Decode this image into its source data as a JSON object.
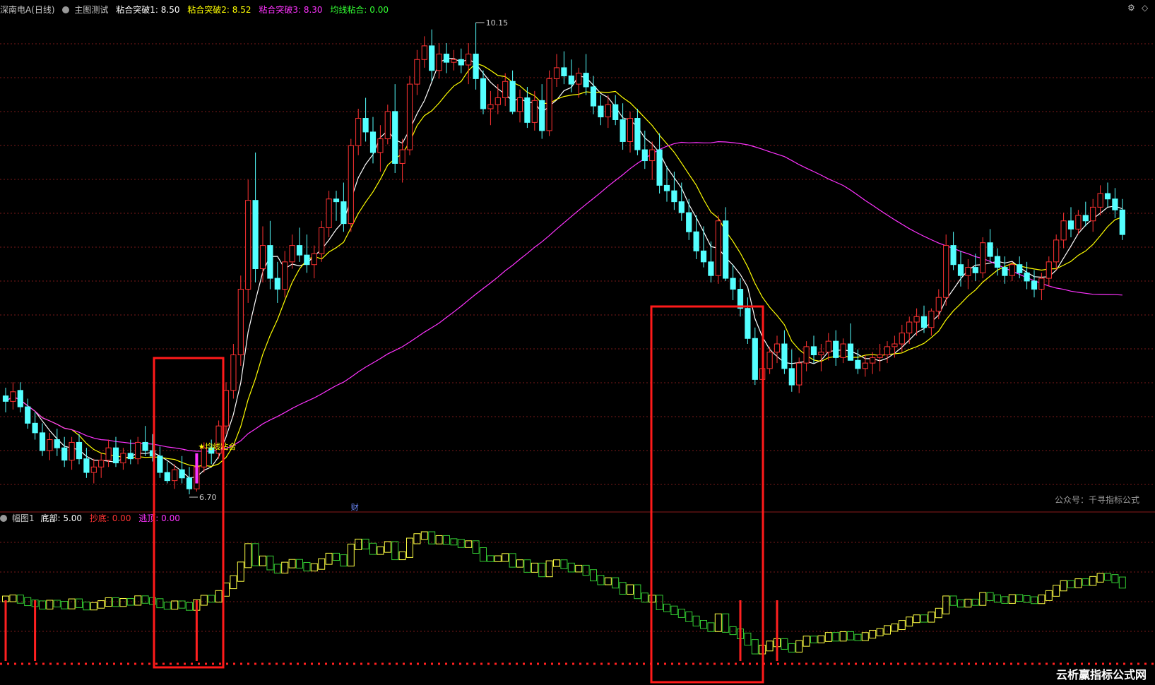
{
  "header": {
    "symbol": "深南电A(日线)",
    "formula": "主图测试",
    "items": [
      {
        "label": "粘合突破1: 8.50",
        "color": "#ffffff"
      },
      {
        "label": "粘合突破2: 8.52",
        "color": "#ffff00"
      },
      {
        "label": "粘合突破3: 8.30",
        "color": "#ff33ff"
      },
      {
        "label": "均线粘合: 0.00",
        "color": "#33ff33"
      }
    ]
  },
  "sub_header": {
    "name": "幅图1",
    "items": [
      {
        "label": "底部: 5.00",
        "color": "#ffffff"
      },
      {
        "label": "抄底: 0.00",
        "color": "#ff3333"
      },
      {
        "label": "逃顶: 0.00",
        "color": "#ff33ff"
      }
    ]
  },
  "annotations": {
    "high": "10.15",
    "low": "6.70",
    "signal": "均线粘合",
    "finance": "财"
  },
  "watermark": "公众号：千寻指标公式",
  "site_watermark": "云析赢指标公式网",
  "colors": {
    "up": "#ff3232",
    "down": "#54ffff",
    "ma5": "#ffffff",
    "ma10": "#ffff00",
    "ma60": "#ff33ff",
    "box": "#ff1a1a"
  },
  "chart_data": {
    "type": "candlestick",
    "price_range": [
      6.7,
      10.15
    ],
    "ohlc": [
      [
        7.42,
        7.48,
        7.3,
        7.38
      ],
      [
        7.38,
        7.52,
        7.32,
        7.45
      ],
      [
        7.46,
        7.52,
        7.3,
        7.34
      ],
      [
        7.34,
        7.4,
        7.18,
        7.22
      ],
      [
        7.22,
        7.3,
        7.1,
        7.15
      ],
      [
        7.15,
        7.22,
        6.98,
        7.02
      ],
      [
        7.02,
        7.15,
        6.95,
        7.1
      ],
      [
        7.1,
        7.18,
        6.98,
        7.04
      ],
      [
        7.04,
        7.12,
        6.9,
        6.95
      ],
      [
        6.95,
        7.12,
        6.88,
        7.08
      ],
      [
        7.08,
        7.14,
        6.92,
        6.96
      ],
      [
        6.96,
        7.04,
        6.82,
        6.86
      ],
      [
        6.86,
        6.96,
        6.78,
        6.9
      ],
      [
        6.9,
        7.0,
        6.82,
        6.95
      ],
      [
        6.95,
        7.1,
        6.9,
        7.04
      ],
      [
        7.04,
        7.12,
        6.9,
        6.93
      ],
      [
        6.93,
        7.04,
        6.88,
        7.0
      ],
      [
        7.0,
        7.1,
        6.92,
        6.96
      ],
      [
        6.96,
        7.12,
        6.92,
        7.08
      ],
      [
        7.08,
        7.2,
        6.98,
        7.02
      ],
      [
        7.02,
        7.14,
        6.94,
        6.98
      ],
      [
        6.98,
        7.05,
        6.82,
        6.86
      ],
      [
        6.86,
        6.94,
        6.78,
        6.8
      ],
      [
        6.8,
        6.92,
        6.74,
        6.88
      ],
      [
        6.88,
        6.98,
        6.78,
        6.82
      ],
      [
        6.82,
        6.9,
        6.7,
        6.74
      ],
      [
        6.74,
        6.94,
        6.72,
        6.9
      ],
      [
        6.9,
        7.08,
        6.86,
        7.04
      ],
      [
        7.04,
        7.1,
        6.92,
        7.0
      ],
      [
        7.0,
        7.24,
        6.96,
        7.2
      ],
      [
        7.2,
        7.52,
        7.14,
        7.46
      ],
      [
        7.46,
        7.8,
        7.4,
        7.72
      ],
      [
        7.72,
        8.3,
        7.64,
        8.2
      ],
      [
        8.2,
        9.0,
        8.1,
        8.85
      ],
      [
        8.85,
        9.2,
        8.25,
        8.35
      ],
      [
        8.35,
        8.66,
        8.25,
        8.52
      ],
      [
        8.52,
        8.7,
        8.2,
        8.28
      ],
      [
        8.28,
        8.4,
        8.1,
        8.2
      ],
      [
        8.2,
        8.48,
        8.14,
        8.4
      ],
      [
        8.4,
        8.6,
        8.35,
        8.52
      ],
      [
        8.52,
        8.65,
        8.4,
        8.45
      ],
      [
        8.45,
        8.6,
        8.32,
        8.38
      ],
      [
        8.38,
        8.52,
        8.28,
        8.46
      ],
      [
        8.46,
        8.7,
        8.4,
        8.65
      ],
      [
        8.65,
        8.92,
        8.58,
        8.86
      ],
      [
        8.86,
        8.92,
        8.7,
        8.84
      ],
      [
        8.84,
        8.98,
        8.62,
        8.68
      ],
      [
        8.68,
        9.3,
        8.62,
        9.25
      ],
      [
        9.25,
        9.52,
        9.18,
        9.45
      ],
      [
        9.45,
        9.6,
        9.28,
        9.35
      ],
      [
        9.35,
        9.46,
        9.12,
        9.2
      ],
      [
        9.2,
        9.4,
        9.06,
        9.3
      ],
      [
        9.3,
        9.55,
        9.26,
        9.5
      ],
      [
        9.5,
        9.7,
        9.05,
        9.12
      ],
      [
        9.12,
        9.3,
        8.98,
        9.22
      ],
      [
        9.22,
        9.76,
        9.18,
        9.7
      ],
      [
        9.7,
        9.95,
        9.62,
        9.88
      ],
      [
        9.88,
        10.05,
        9.82,
        9.98
      ],
      [
        9.98,
        10.1,
        9.72,
        9.8
      ],
      [
        9.8,
        10.0,
        9.74,
        9.92
      ],
      [
        9.92,
        10.0,
        9.78,
        9.86
      ],
      [
        9.86,
        9.95,
        9.8,
        9.88
      ],
      [
        9.88,
        9.96,
        9.78,
        9.84
      ],
      [
        9.84,
        10.0,
        9.7,
        9.92
      ],
      [
        9.92,
        10.15,
        9.66,
        9.74
      ],
      [
        9.74,
        9.8,
        9.48,
        9.52
      ],
      [
        9.52,
        9.65,
        9.4,
        9.55
      ],
      [
        9.55,
        9.7,
        9.48,
        9.6
      ],
      [
        9.6,
        9.78,
        9.54,
        9.72
      ],
      [
        9.72,
        9.8,
        9.48,
        9.5
      ],
      [
        9.5,
        9.66,
        9.42,
        9.6
      ],
      [
        9.6,
        9.68,
        9.38,
        9.42
      ],
      [
        9.42,
        9.65,
        9.36,
        9.58
      ],
      [
        9.58,
        9.7,
        9.3,
        9.36
      ],
      [
        9.36,
        9.8,
        9.32,
        9.74
      ],
      [
        9.74,
        9.92,
        9.68,
        9.82
      ],
      [
        9.82,
        9.94,
        9.7,
        9.76
      ],
      [
        9.76,
        9.88,
        9.64,
        9.7
      ],
      [
        9.7,
        9.82,
        9.6,
        9.78
      ],
      [
        9.78,
        9.92,
        9.62,
        9.68
      ],
      [
        9.68,
        9.76,
        9.48,
        9.54
      ],
      [
        9.54,
        9.62,
        9.4,
        9.46
      ],
      [
        9.46,
        9.62,
        9.38,
        9.55
      ],
      [
        9.55,
        9.62,
        9.4,
        9.44
      ],
      [
        9.44,
        9.56,
        9.22,
        9.28
      ],
      [
        9.28,
        9.5,
        9.2,
        9.45
      ],
      [
        9.45,
        9.52,
        9.18,
        9.22
      ],
      [
        9.22,
        9.36,
        9.08,
        9.14
      ],
      [
        9.14,
        9.28,
        9.0,
        9.22
      ],
      [
        9.22,
        9.34,
        8.9,
        8.96
      ],
      [
        8.96,
        9.1,
        8.84,
        8.92
      ],
      [
        8.92,
        9.06,
        8.78,
        8.84
      ],
      [
        8.84,
        8.98,
        8.7,
        8.76
      ],
      [
        8.76,
        8.86,
        8.56,
        8.62
      ],
      [
        8.62,
        8.74,
        8.42,
        8.48
      ],
      [
        8.48,
        8.66,
        8.36,
        8.4
      ],
      [
        8.4,
        8.55,
        8.25,
        8.3
      ],
      [
        8.3,
        8.74,
        8.24,
        8.7
      ],
      [
        8.7,
        8.8,
        8.26,
        8.28
      ],
      [
        8.28,
        8.38,
        8.12,
        8.2
      ],
      [
        8.2,
        8.28,
        8.0,
        8.06
      ],
      [
        8.06,
        8.14,
        7.8,
        7.84
      ],
      [
        7.84,
        7.92,
        7.5,
        7.54
      ],
      [
        7.54,
        7.66,
        7.46,
        7.62
      ],
      [
        7.62,
        7.78,
        7.58,
        7.74
      ],
      [
        7.74,
        7.86,
        7.66,
        7.8
      ],
      [
        7.8,
        7.9,
        7.58,
        7.62
      ],
      [
        7.62,
        7.76,
        7.45,
        7.5
      ],
      [
        7.5,
        7.7,
        7.44,
        7.66
      ],
      [
        7.66,
        7.82,
        7.6,
        7.78
      ],
      [
        7.78,
        7.86,
        7.66,
        7.72
      ],
      [
        7.72,
        7.8,
        7.6,
        7.74
      ],
      [
        7.74,
        7.88,
        7.68,
        7.82
      ],
      [
        7.82,
        7.9,
        7.64,
        7.7
      ],
      [
        7.7,
        7.84,
        7.66,
        7.8
      ],
      [
        7.8,
        7.95,
        7.72,
        7.68
      ],
      [
        7.68,
        7.76,
        7.58,
        7.62
      ],
      [
        7.62,
        7.72,
        7.56,
        7.66
      ],
      [
        7.66,
        7.74,
        7.58,
        7.7
      ],
      [
        7.7,
        7.8,
        7.6,
        7.72
      ],
      [
        7.72,
        7.82,
        7.66,
        7.78
      ],
      [
        7.78,
        7.86,
        7.7,
        7.8
      ],
      [
        7.8,
        7.94,
        7.74,
        7.88
      ],
      [
        7.88,
        8.0,
        7.8,
        7.96
      ],
      [
        7.96,
        8.06,
        7.86,
        8.0
      ],
      [
        8.0,
        8.08,
        7.88,
        7.92
      ],
      [
        7.92,
        8.06,
        7.86,
        8.04
      ],
      [
        8.04,
        8.2,
        7.98,
        8.14
      ],
      [
        8.14,
        8.6,
        8.08,
        8.52
      ],
      [
        8.52,
        8.62,
        8.34,
        8.38
      ],
      [
        8.38,
        8.48,
        8.22,
        8.3
      ],
      [
        8.3,
        8.42,
        8.2,
        8.36
      ],
      [
        8.36,
        8.46,
        8.26,
        8.32
      ],
      [
        8.32,
        8.58,
        8.28,
        8.54
      ],
      [
        8.54,
        8.64,
        8.4,
        8.44
      ],
      [
        8.44,
        8.5,
        8.3,
        8.36
      ],
      [
        8.36,
        8.44,
        8.24,
        8.3
      ],
      [
        8.3,
        8.4,
        8.26,
        8.38
      ],
      [
        8.38,
        8.44,
        8.28,
        8.32
      ],
      [
        8.32,
        8.4,
        8.2,
        8.26
      ],
      [
        8.26,
        8.34,
        8.14,
        8.2
      ],
      [
        8.2,
        8.32,
        8.12,
        8.28
      ],
      [
        8.28,
        8.44,
        8.22,
        8.4
      ],
      [
        8.4,
        8.6,
        8.34,
        8.56
      ],
      [
        8.56,
        8.76,
        8.5,
        8.7
      ],
      [
        8.7,
        8.8,
        8.58,
        8.64
      ],
      [
        8.64,
        8.78,
        8.6,
        8.74
      ],
      [
        8.74,
        8.84,
        8.66,
        8.7
      ],
      [
        8.7,
        8.86,
        8.62,
        8.8
      ],
      [
        8.8,
        8.96,
        8.74,
        8.9
      ],
      [
        8.9,
        8.98,
        8.8,
        8.86
      ],
      [
        8.86,
        8.94,
        8.72,
        8.78
      ],
      [
        8.78,
        8.86,
        8.56,
        8.6
      ]
    ],
    "ma_series": [
      {
        "name": "MA5",
        "color": "#ffffff"
      },
      {
        "name": "MA10",
        "color": "#ffff00"
      },
      {
        "name": "MA60",
        "color": "#ff33ff"
      }
    ],
    "sub_indicator": {
      "base": 5.0,
      "spike_bars": [
        0,
        4,
        26,
        100,
        105
      ]
    }
  }
}
